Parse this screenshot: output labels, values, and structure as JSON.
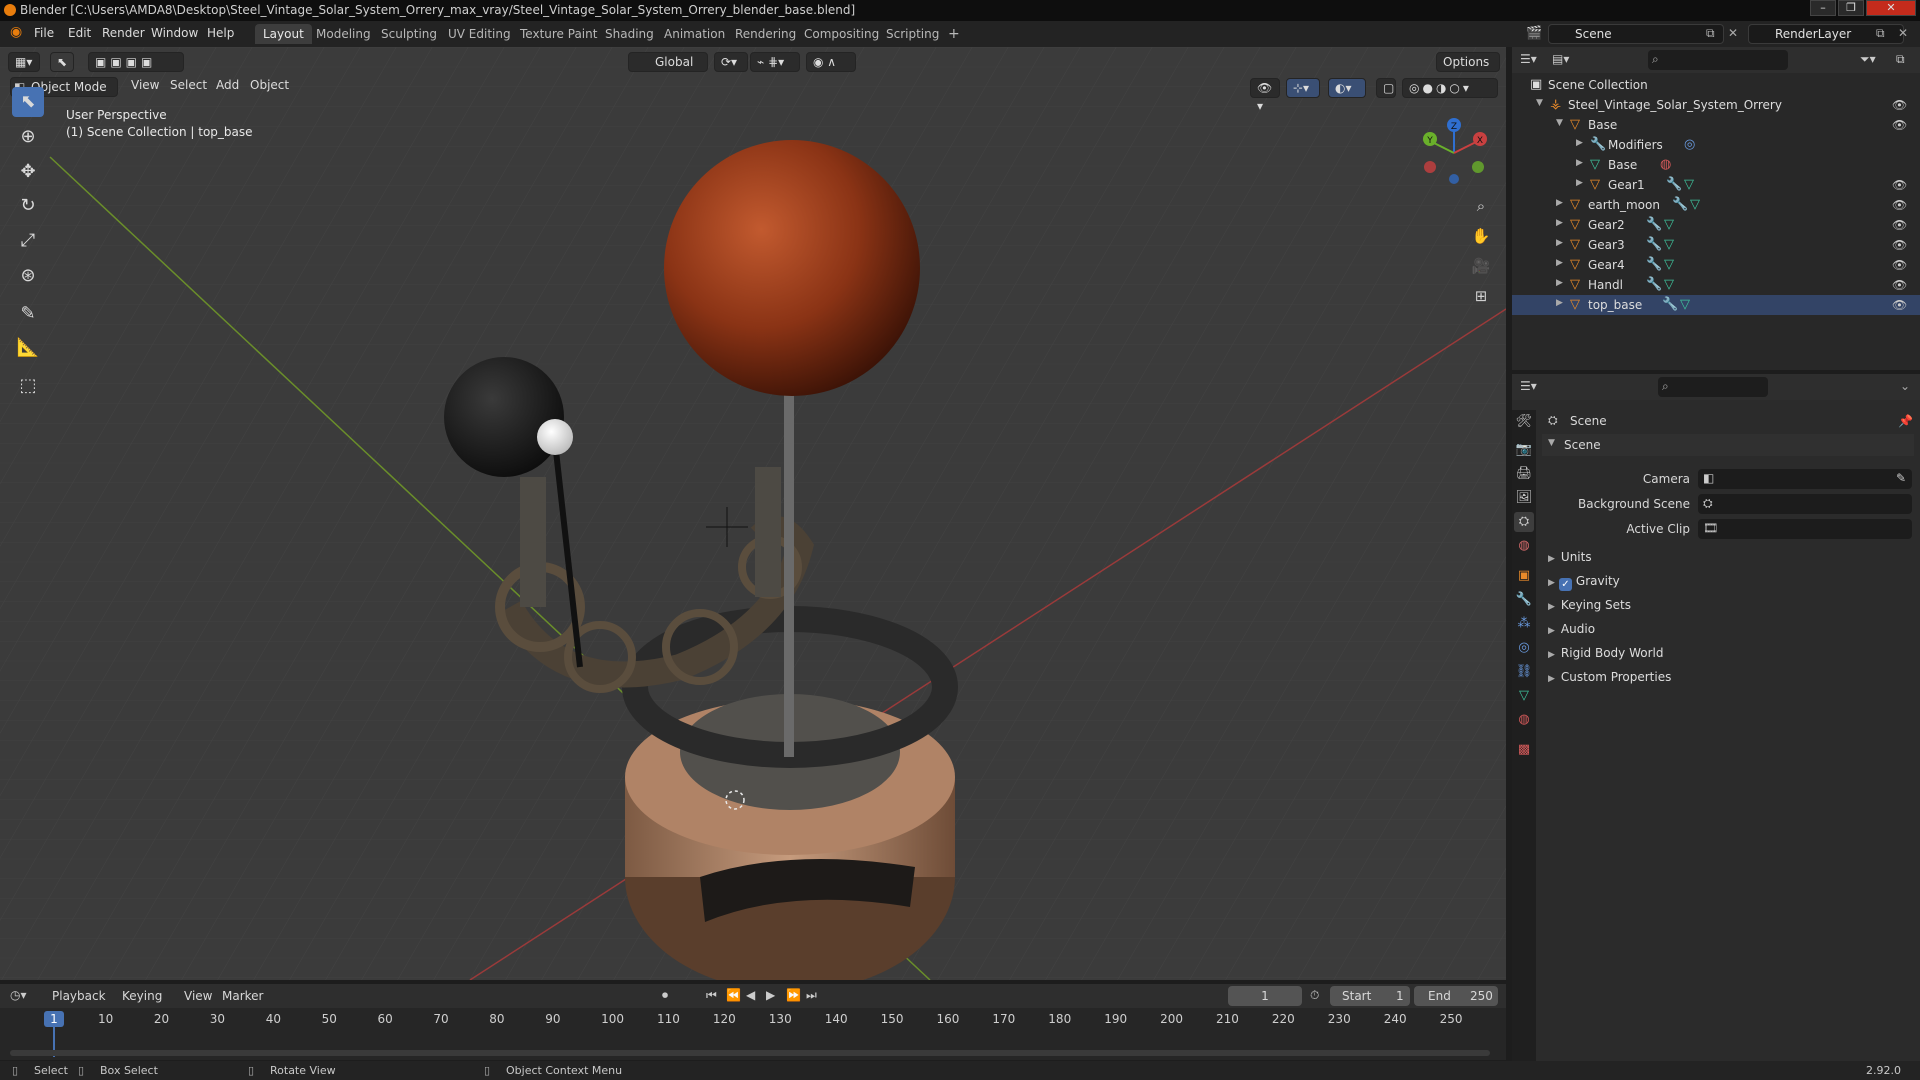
{
  "window": {
    "title": "Blender [C:\\Users\\AMDA8\\Desktop\\Steel_Vintage_Solar_System_Orrery_max_vray/Steel_Vintage_Solar_System_Orrery_blender_base.blend]",
    "controls": [
      "–",
      "❐",
      "✕"
    ]
  },
  "menubar": {
    "items": [
      "File",
      "Edit",
      "Render",
      "Window",
      "Help"
    ],
    "workspaces": [
      "Layout",
      "Modeling",
      "Sculpting",
      "UV Editing",
      "Texture Paint",
      "Shading",
      "Animation",
      "Rendering",
      "Compositing",
      "Scripting"
    ],
    "active_workspace": "Layout",
    "add_tab": "+",
    "scene": "Scene",
    "view_layer": "RenderLayer"
  },
  "viewport": {
    "mode": "Object Mode",
    "menus": [
      "View",
      "Select",
      "Add",
      "Object"
    ],
    "transform_orientation": "Global",
    "options_label": "Options",
    "overlay_line1": "User Perspective",
    "overlay_line2": "(1) Scene Collection | top_base",
    "gizmo_axes": [
      "X",
      "Y",
      "Z"
    ]
  },
  "outliner": {
    "root": "Scene Collection",
    "rows": [
      {
        "label": "Steel_Vintage_Solar_System_Orrery"
      },
      {
        "label": "Base"
      },
      {
        "label": "Modifiers"
      },
      {
        "label": "Base"
      },
      {
        "label": "Gear1"
      },
      {
        "label": "earth_moon"
      },
      {
        "label": "Gear2"
      },
      {
        "label": "Gear3"
      },
      {
        "label": "Gear4"
      },
      {
        "label": "Handl"
      },
      {
        "label": "top_base"
      }
    ]
  },
  "properties": {
    "context": "Scene",
    "panel_title": "Scene",
    "fields": [
      {
        "label": "Camera"
      },
      {
        "label": "Background Scene"
      },
      {
        "label": "Active Clip"
      }
    ],
    "subpanels": [
      "Units",
      "Gravity",
      "Keying Sets",
      "Audio",
      "Rigid Body World",
      "Custom Properties"
    ],
    "gravity_checked": true
  },
  "timeline": {
    "menus": [
      "Playback",
      "Keying",
      "View",
      "Marker"
    ],
    "current_frame": "1",
    "start_label": "Start",
    "start": "1",
    "end_label": "End",
    "end": "250",
    "ruler": [
      "10",
      "20",
      "30",
      "40",
      "50",
      "60",
      "70",
      "80",
      "90",
      "100",
      "110",
      "120",
      "130",
      "140",
      "150",
      "160",
      "170",
      "180",
      "190",
      "200",
      "210",
      "220",
      "230",
      "240",
      "250"
    ],
    "playhead": "1"
  },
  "statusbar": {
    "select": "Select",
    "box_select": "Box Select",
    "rotate": "Rotate View",
    "context_menu": "Object Context Menu",
    "version": "2.92.0"
  }
}
